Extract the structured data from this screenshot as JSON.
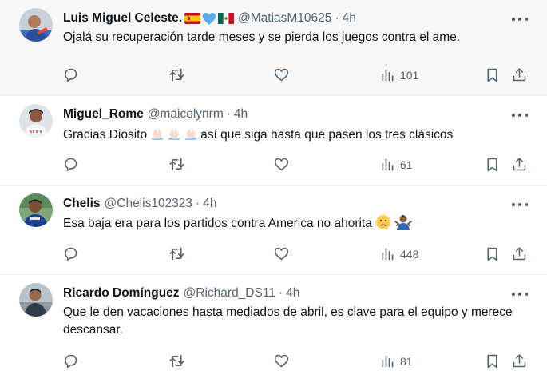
{
  "tweets": [
    {
      "name": "Luis Miguel Celeste.",
      "handle": "@MatiasM10625",
      "separator": "·",
      "time": "4h",
      "text": "Ojalá su recuperación tarde meses y se pierda los juegos contra el ame.",
      "views": "101",
      "flags": [
        "spain-flag-icon",
        "blue-heart-icon",
        "mexico-flag-icon"
      ]
    },
    {
      "name": "Miguel_Rome",
      "handle": "@maicolynrm",
      "separator": "·",
      "time": "4h",
      "text_before": "Gracias Diosito",
      "text_after": "así que siga hasta que pasen los tres clásicos",
      "views": "61"
    },
    {
      "name": "Chelis",
      "handle": "@Chelis102323",
      "separator": "·",
      "time": "4h",
      "text": "Esa baja era para los partidos contra America no ahorita",
      "views": "448"
    },
    {
      "name": "Ricardo Domínguez",
      "handle": "@Richard_DS11",
      "separator": "·",
      "time": "4h",
      "text": "Que le den vacaciones hasta mediados de abril, es clave para el equipo y merece descansar.",
      "views": "81"
    }
  ],
  "icons": {
    "reply": "reply-icon",
    "retweet": "retweet-icon",
    "like": "like-icon",
    "views": "views-icon",
    "bookmark": "bookmark-icon",
    "share": "share-icon",
    "more": "more-icon"
  },
  "colors": {
    "icon": "#536471",
    "text": "#0f1419",
    "highlight_bg": "#f7f7f7"
  }
}
